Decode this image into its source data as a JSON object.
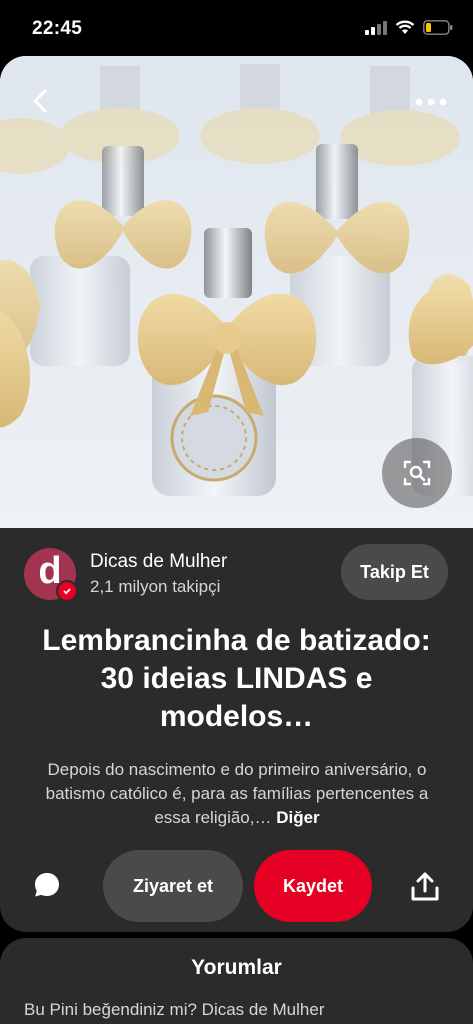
{
  "status_bar": {
    "time": "22:45"
  },
  "pin": {
    "author": {
      "avatar_letter": "d",
      "name": "Dicas de Mulher",
      "followers": "2,1 milyon takipçi",
      "follow_label": "Takip Et"
    },
    "title": "Lembrancinha de batizado: 30 ideias LINDAS e modelos…",
    "description": "Depois do nascimento e do primeiro aniversário, o batismo católico é, para as famílias pertencentes a essa religião,…",
    "more_label": "Diğer"
  },
  "actions": {
    "visit_label": "Ziyaret et",
    "save_label": "Kaydet"
  },
  "comments": {
    "title": "Yorumlar",
    "prompt": "Bu Pini beğendiniz mi? Dicas de Mulher"
  },
  "colors": {
    "save": "#e60023",
    "panel": "#2b2b2b",
    "avatar": "#a33450"
  },
  "icons": [
    "back-icon",
    "more-icon",
    "visual-search-icon",
    "comment-icon",
    "share-icon"
  ]
}
